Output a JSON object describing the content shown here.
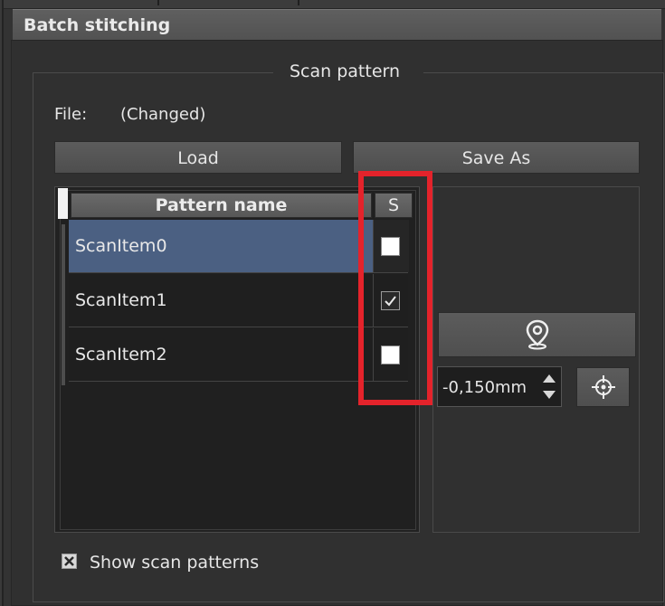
{
  "panel": {
    "title": "Batch stitching"
  },
  "scan_pattern": {
    "group_title": "Scan pattern",
    "file_label": "File:",
    "file_value": "(Changed)",
    "load_label": "Load",
    "save_as_label": "Save As"
  },
  "table": {
    "col_name": "Pattern name",
    "col_s": "S",
    "rows": [
      {
        "name": "ScanItem0",
        "checked": false,
        "selected": true
      },
      {
        "name": "ScanItem1",
        "checked": true,
        "selected": false
      },
      {
        "name": "ScanItem2",
        "checked": false,
        "selected": false
      }
    ]
  },
  "controls": {
    "location_icon": "location-pin-icon",
    "offset_value": "-0,150mm",
    "target_icon": "crosshair-icon"
  },
  "show_scan_patterns": {
    "label": "Show scan patterns",
    "checked": true
  },
  "colors": {
    "selected_row": "#4b6082",
    "highlight": "#e4232b"
  }
}
